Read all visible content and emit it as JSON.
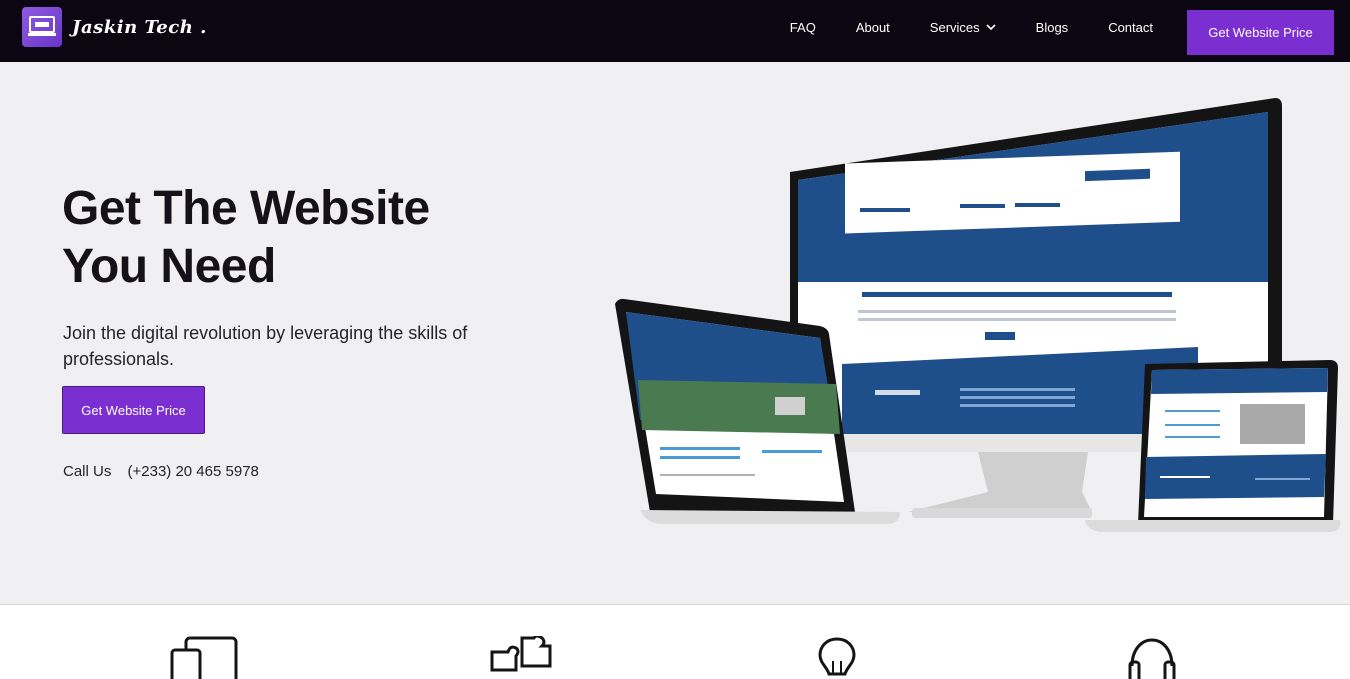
{
  "brand": {
    "name": "Jaskin Tech .",
    "logo_icon": "laptop-logo-icon"
  },
  "nav": {
    "items": [
      "FAQ",
      "About",
      "Services",
      "Blogs",
      "Contact"
    ],
    "cta": "Get Website Price",
    "dropdown_icon": "chevron-down-icon"
  },
  "hero": {
    "title": "Get The Website You Need",
    "subtitle": "Join the digital revolution by leveraging the skills of professionals.",
    "button": "Get Website Price",
    "call_label": "Call Us",
    "phone": "(+233) 20 465 5978"
  },
  "features": {
    "icons": [
      "devices-icon",
      "puzzle-icon",
      "lightbulb-icon",
      "headset-icon"
    ]
  },
  "colors": {
    "header_bg": "#0c0612",
    "accent": "#7b2fd1",
    "hero_bg": "#f0eff1",
    "screen_blue": "#1f4f8b"
  }
}
